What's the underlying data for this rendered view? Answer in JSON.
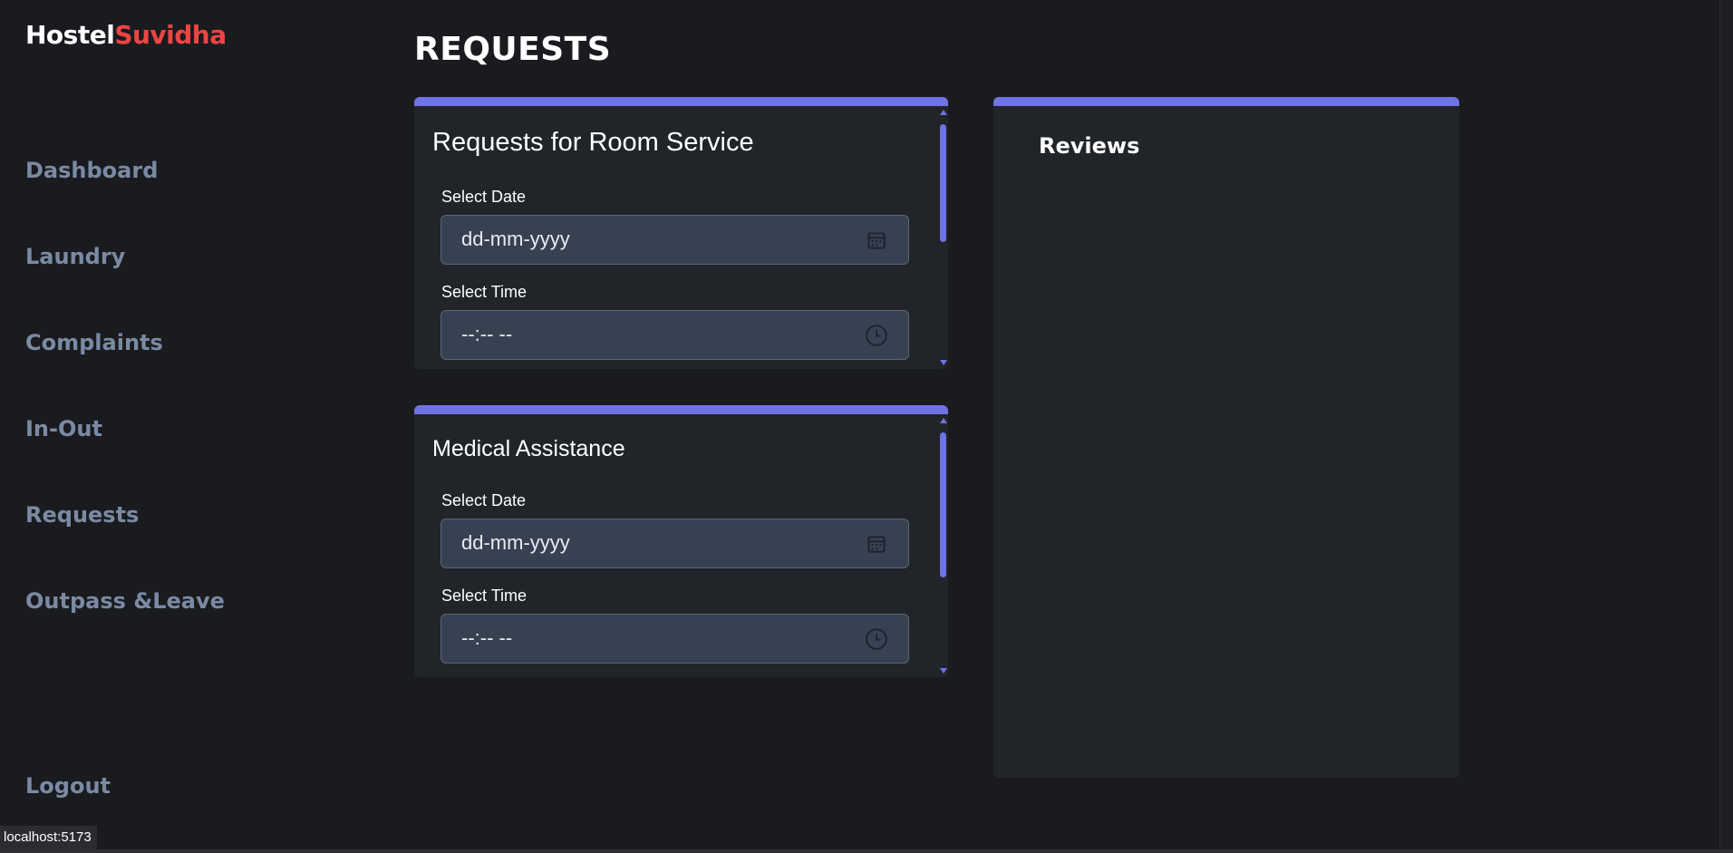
{
  "brand": {
    "name_part1": "Hostel",
    "name_part2": "Suvidha",
    "accent_color": "#ef4444"
  },
  "sidebar": {
    "items": [
      {
        "label": "Dashboard"
      },
      {
        "label": "Laundry"
      },
      {
        "label": "Complaints"
      },
      {
        "label": "In-Out"
      },
      {
        "label": "Requests"
      },
      {
        "label": "Outpass &Leave"
      }
    ],
    "logout_label": "Logout"
  },
  "page": {
    "title": "REQUESTS"
  },
  "room_service": {
    "title": "Requests for Room Service",
    "date_label": "Select Date",
    "date_value": "dd-mm-yyyy",
    "time_label": "Select Time",
    "time_value": "--:-- --",
    "date_icon": "calendar-icon",
    "time_icon": "clock-icon"
  },
  "medical": {
    "title": "Medical Assistance",
    "date_label": "Select Date",
    "date_value": "dd-mm-yyyy",
    "time_label": "Select Time",
    "time_value": "--:-- --",
    "date_icon": "calendar-icon",
    "time_icon": "clock-icon"
  },
  "reviews": {
    "title": "Reviews"
  },
  "status_bar": {
    "url": "localhost:5173"
  },
  "colors": {
    "card_accent": "#6f73e4",
    "nav_text": "#7b8aa3",
    "background": "#1a1b1f",
    "card_bg": "#212428",
    "field_bg": "#384152"
  }
}
